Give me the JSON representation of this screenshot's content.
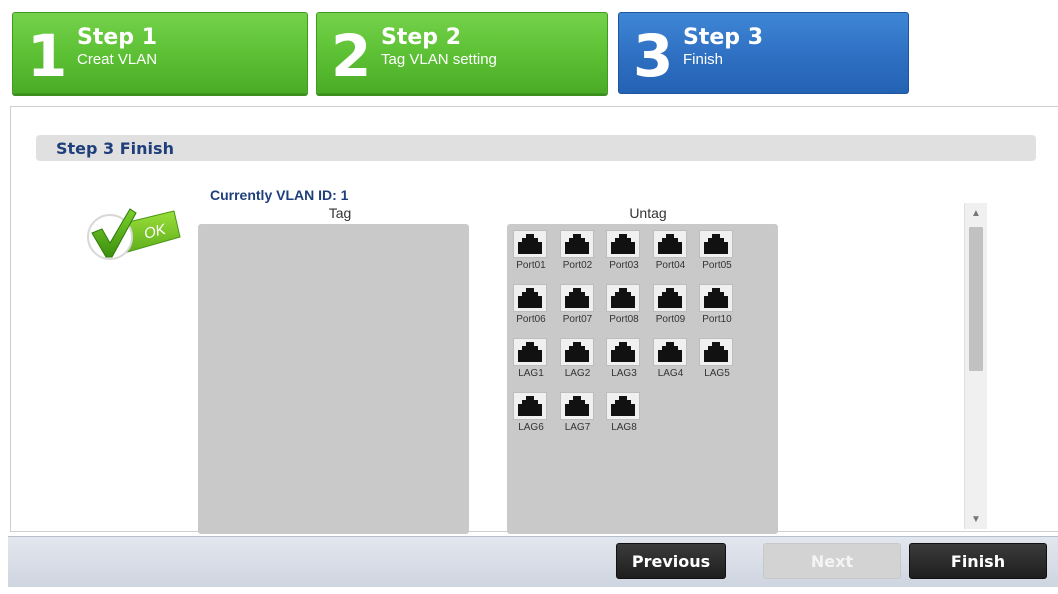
{
  "steps": [
    {
      "number": "1",
      "title": "Step 1",
      "subtitle": "Creat VLAN",
      "state": "done"
    },
    {
      "number": "2",
      "title": "Step 2",
      "subtitle": "Tag VLAN setting",
      "state": "done"
    },
    {
      "number": "3",
      "title": "Step 3",
      "subtitle": "Finish",
      "state": "active"
    }
  ],
  "section": {
    "title": "Step 3 Finish"
  },
  "vlan": {
    "label": "Currently VLAN ID: 1",
    "tag_title": "Tag",
    "untag_title": "Untag",
    "tag_ports": [],
    "untag_ports": [
      "Port01",
      "Port02",
      "Port03",
      "Port04",
      "Port05",
      "Port06",
      "Port07",
      "Port08",
      "Port09",
      "Port10",
      "LAG1",
      "LAG2",
      "LAG3",
      "LAG4",
      "LAG5",
      "LAG6",
      "LAG7",
      "LAG8"
    ]
  },
  "icons": {
    "ok": "ok-check-icon",
    "port": "ethernet-port-icon"
  },
  "ok_text": "OK",
  "buttons": {
    "previous": "Previous",
    "next": "Next",
    "finish": "Finish"
  },
  "colors": {
    "step_done": "#5bbf33",
    "step_active": "#2e6fc2",
    "accent_text": "#1f3f7a"
  }
}
